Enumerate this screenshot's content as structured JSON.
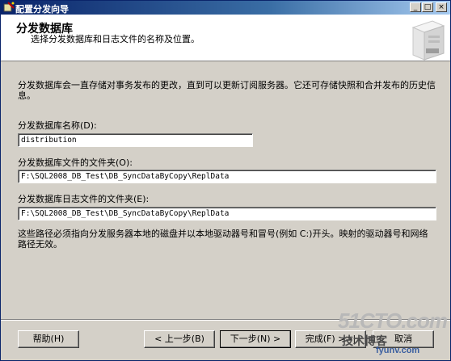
{
  "window": {
    "title": "配置分发向导",
    "controls": [
      "_",
      "□",
      "×"
    ]
  },
  "header": {
    "title": "分发数据库",
    "subtitle": "选择分发数据库和日志文件的名称及位置。"
  },
  "main": {
    "description": "分发数据库会一直存储对事务发布的更改，直到可以更新订阅服务器。它还可存储快照和合并发布的历史信息。",
    "db_name_label": "分发数据库名称(D):",
    "db_name_value": "distribution",
    "data_folder_label": "分发数据库文件的文件夹(O):",
    "data_folder_value": "F:\\SQL2008_DB_Test\\DB_SyncDataByCopy\\ReplData",
    "log_folder_label": "分发数据库日志文件的文件夹(E):",
    "log_folder_value": "F:\\SQL2008_DB_Test\\DB_SyncDataByCopy\\ReplData",
    "note": "这些路径必须指向分发服务器本地的磁盘并以本地驱动器号和冒号(例如 C:)开头。映射的驱动器号和网络路径无效。"
  },
  "footer": {
    "help_label": "帮助(H)",
    "back_label": "< 上一步(B)",
    "next_label": "下一步(N) >",
    "finish_label": "完成(F) >>|",
    "cancel_label": "取消"
  },
  "watermark": {
    "main": "51CTO.com",
    "line1": "技术博客",
    "line2": "fyunv.com"
  },
  "icons": {
    "app": "wizard-app-icon",
    "header_art": "server-graphic"
  }
}
